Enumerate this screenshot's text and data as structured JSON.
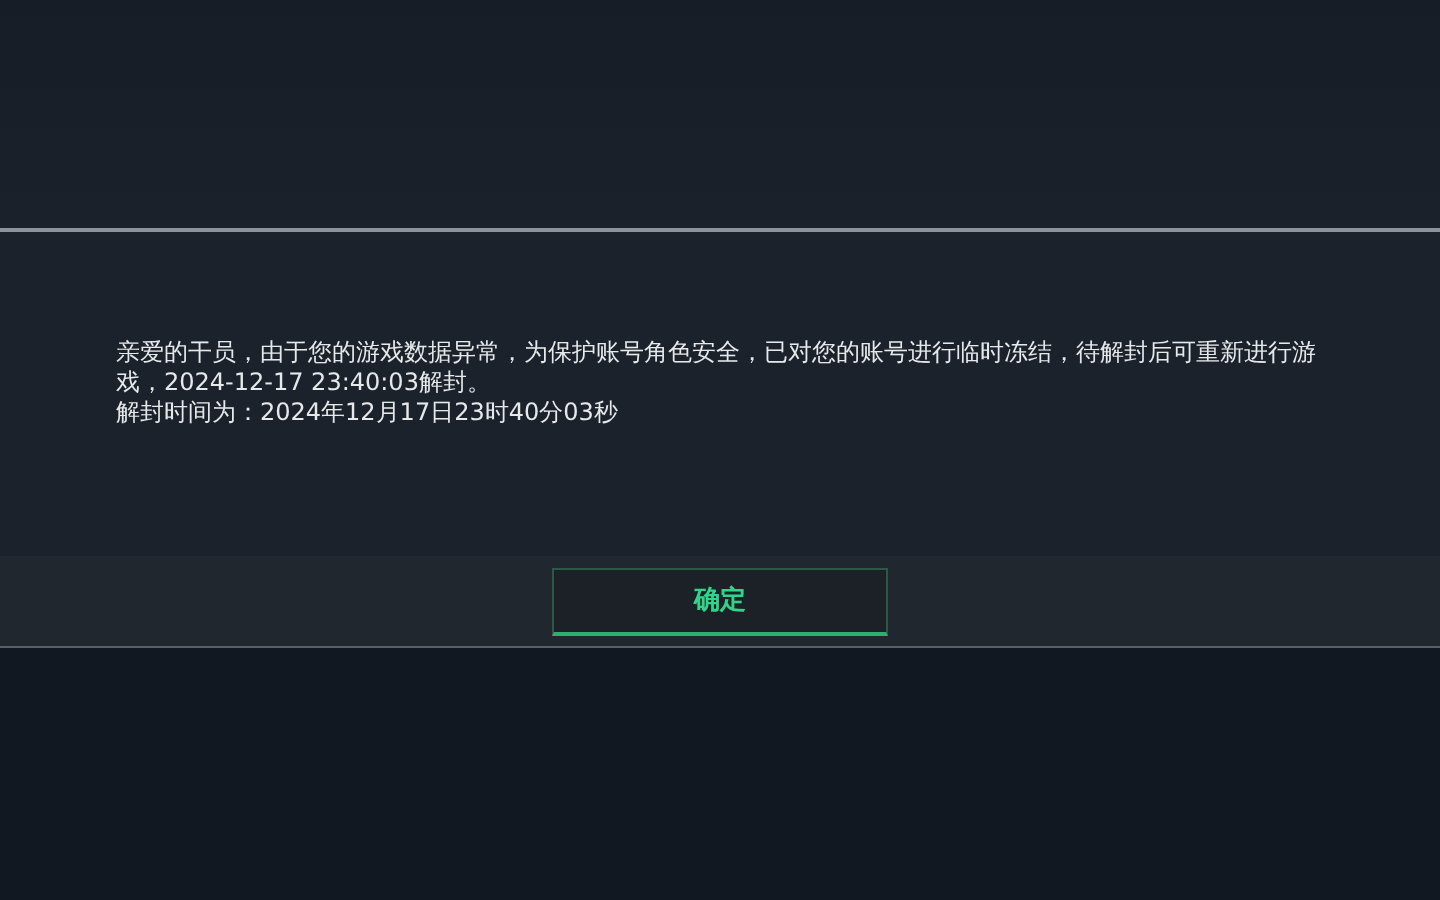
{
  "dialog": {
    "paragraphs": [
      "亲爱的干员，由于您的游戏数据异常，为保护账号角色安全，已对您的账号进行临时冻结，待解封后可重新进行游戏，2024-12-17 23:40:03解封。",
      "解封时间为：2024年12月17日23时40分03秒"
    ],
    "button": "确定"
  }
}
